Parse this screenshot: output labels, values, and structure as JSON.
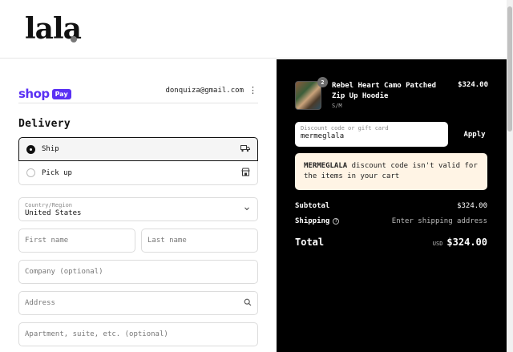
{
  "header": {
    "logo_text": "lala"
  },
  "account": {
    "shoppay_brand": "shop",
    "shoppay_badge": "Pay",
    "email": "donquiza@gmail.com",
    "menu_icon": "⋮"
  },
  "delivery": {
    "title": "Delivery",
    "options": [
      {
        "label": "Ship",
        "icon": "truck-icon",
        "selected": true
      },
      {
        "label": "Pick up",
        "icon": "store-icon",
        "selected": false
      }
    ]
  },
  "address_form": {
    "country_label": "Country/Region",
    "country_value": "United States",
    "first_name_placeholder": "First name",
    "last_name_placeholder": "Last name",
    "company_placeholder": "Company (optional)",
    "address_placeholder": "Address",
    "apartment_placeholder": "Apartment, suite, etc. (optional)"
  },
  "order": {
    "item": {
      "quantity": "2",
      "name": "Rebel Heart Camo Patched Zip Up Hoodie",
      "variant": "S/M",
      "price": "$324.00"
    },
    "discount": {
      "placeholder": "Discount code or gift card",
      "value": "mermeglala",
      "apply_label": "Apply"
    },
    "error": {
      "code": "MERMEGLALA",
      "message": " discount code isn't valid for the items in your cart"
    },
    "summary": {
      "subtotal_label": "Subtotal",
      "subtotal_value": "$324.00",
      "shipping_label": "Shipping",
      "shipping_value": "Enter shipping address",
      "total_label": "Total",
      "currency": "USD",
      "total_value": "$324.00"
    }
  },
  "colors": {
    "shoppay": "#5a31f4",
    "summary_bg": "#000000",
    "error_bg": "#fff4e5"
  }
}
